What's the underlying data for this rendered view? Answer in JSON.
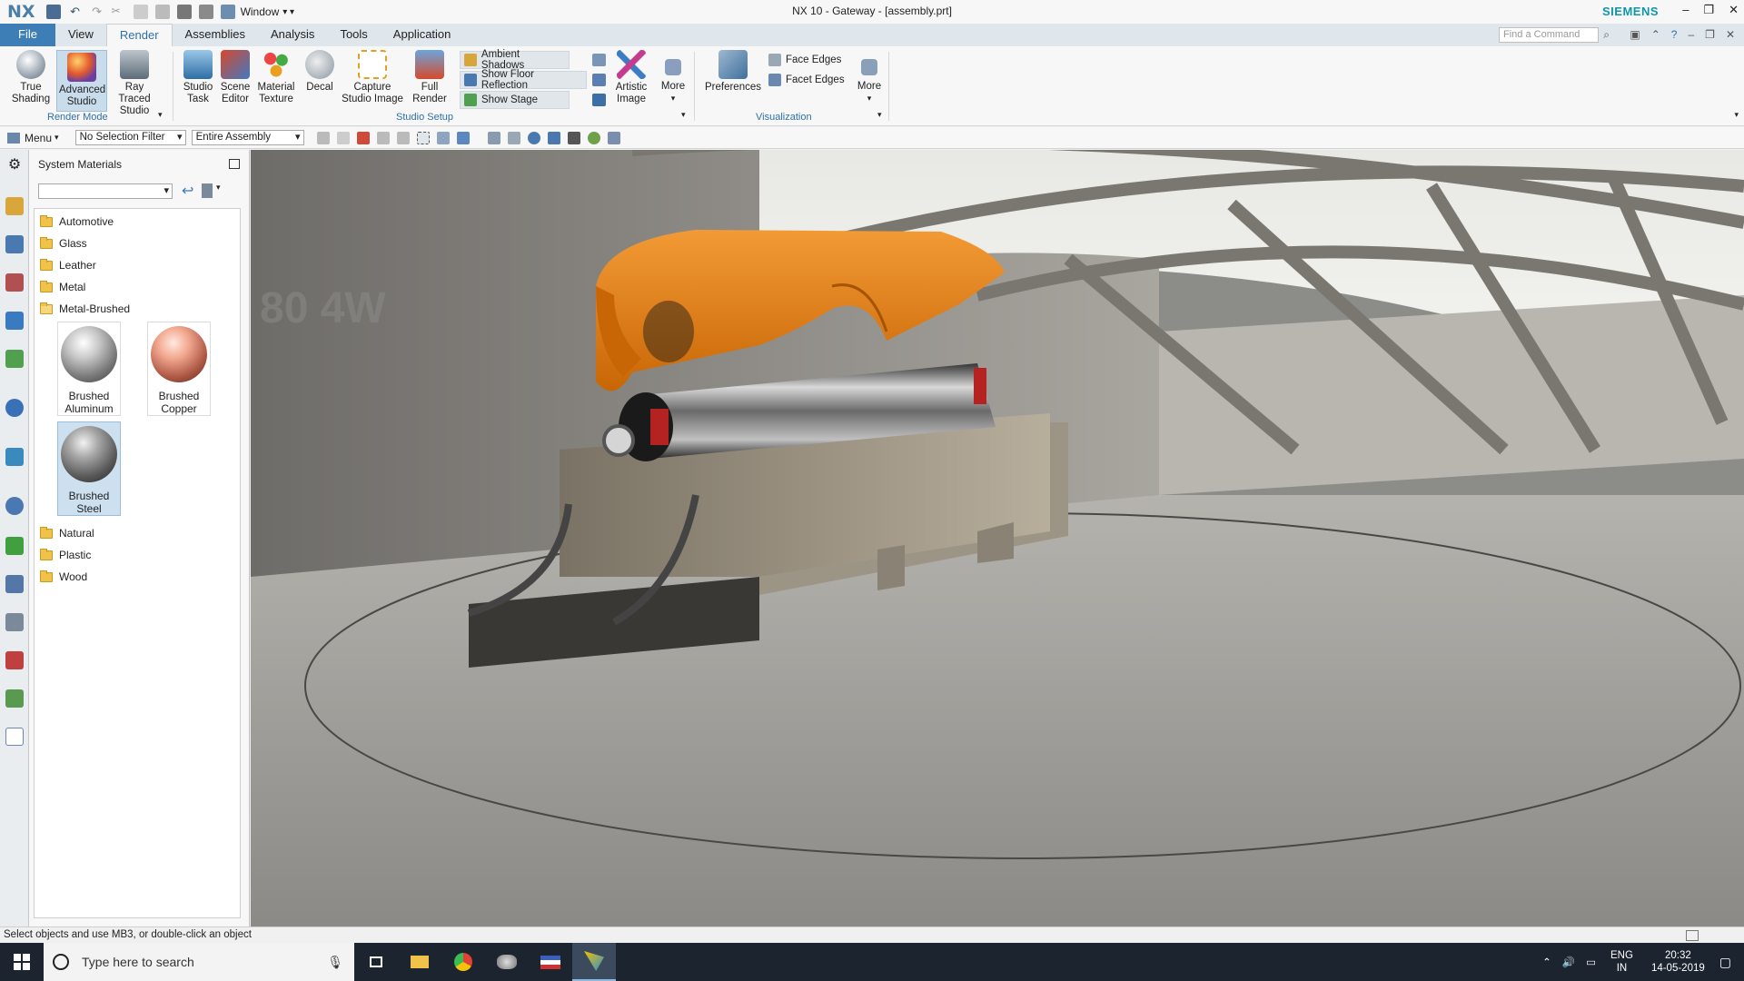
{
  "titlebar": {
    "logo": "NX",
    "window_menu": "Window",
    "title": "NX 10 - Gateway - [assembly.prt]",
    "brand": "SIEMENS"
  },
  "tabs": {
    "items": [
      "File",
      "View",
      "Render",
      "Assemblies",
      "Analysis",
      "Tools",
      "Application"
    ],
    "active": "Render",
    "find_placeholder": "Find a Command"
  },
  "ribbon": {
    "render_mode": {
      "label": "Render Mode",
      "buttons": [
        "True Shading",
        "Advanced Studio",
        "Ray Traced Studio"
      ]
    },
    "studio_setup": {
      "label": "Studio Setup",
      "buttons": [
        "Studio Task",
        "Scene Editor",
        "Material Texture",
        "Decal",
        "Capture Studio Image",
        "Full Render"
      ],
      "toggles": [
        "Ambient Shadows",
        "Show Floor Reflection",
        "Show Stage"
      ],
      "extra_buttons": [
        "Artistic Image",
        "More"
      ]
    },
    "visualization": {
      "label": "Visualization",
      "buttons": [
        "Preferences"
      ],
      "toggles": [
        "Face Edges",
        "Facet Edges"
      ],
      "more": "More"
    }
  },
  "selection_bar": {
    "menu": "Menu",
    "filter": "No Selection Filter",
    "scope": "Entire Assembly"
  },
  "materials_panel": {
    "title": "System Materials",
    "folders_top": [
      "Automotive",
      "Glass",
      "Leather",
      "Metal",
      "Metal-Brushed"
    ],
    "materials": [
      {
        "line1": "Brushed",
        "line2": "Aluminum"
      },
      {
        "line1": "Brushed",
        "line2": "Copper"
      },
      {
        "line1": "Brushed",
        "line2": "Steel"
      }
    ],
    "selected_material": "Brushed Steel",
    "folders_bottom": [
      "Natural",
      "Plastic",
      "Wood"
    ]
  },
  "viewport": {
    "wall_stencil": "80 4W"
  },
  "status": {
    "text": "Select objects and use MB3, or double-click an object"
  },
  "taskbar": {
    "search_placeholder": "Type here to search",
    "lang1": "ENG",
    "lang2": "IN",
    "time": "20:32",
    "date": "14-05-2019"
  },
  "colors": {
    "accent": "#2f6fa7",
    "file_tab": "#3e7eb6",
    "brand": "#0e97a8",
    "machine_cover": "#e87a10"
  }
}
